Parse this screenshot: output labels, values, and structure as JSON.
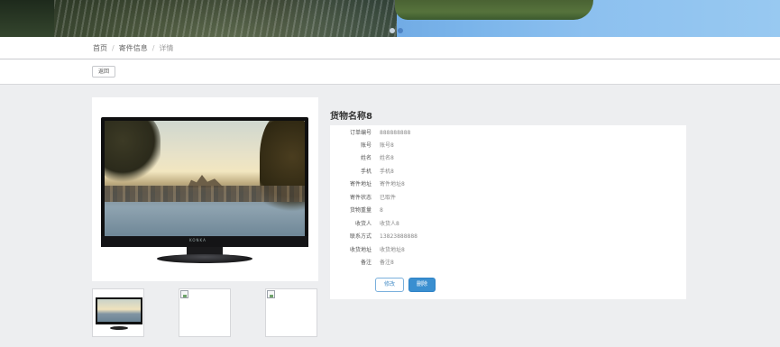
{
  "breadcrumb": {
    "home": "首页",
    "section": "寄件信息",
    "current": "详情",
    "separator": "/"
  },
  "toolbar": {
    "back_label": "返回"
  },
  "product": {
    "title": "货物名称8",
    "tv_brand": "KONKA"
  },
  "details": [
    {
      "label": "订单编号",
      "value": "888888888"
    },
    {
      "label": "账号",
      "value": "账号8"
    },
    {
      "label": "姓名",
      "value": "姓名8"
    },
    {
      "label": "手机",
      "value": "手机8"
    },
    {
      "label": "寄件地址",
      "value": "寄件地址8"
    },
    {
      "label": "寄件状态",
      "value": "已取件"
    },
    {
      "label": "货物重量",
      "value": "8"
    },
    {
      "label": "收货人",
      "value": "收货人8"
    },
    {
      "label": "联系方式",
      "value": "13823888888"
    },
    {
      "label": "收货地址",
      "value": "收货地址8"
    },
    {
      "label": "备注",
      "value": "备注8"
    }
  ],
  "actions": {
    "edit_label": "修改",
    "delete_label": "删除"
  },
  "colors": {
    "primary": "#3a8fd0",
    "page_bg": "#edeef0"
  },
  "banner": {
    "slides": 2,
    "active_slide": 2
  }
}
